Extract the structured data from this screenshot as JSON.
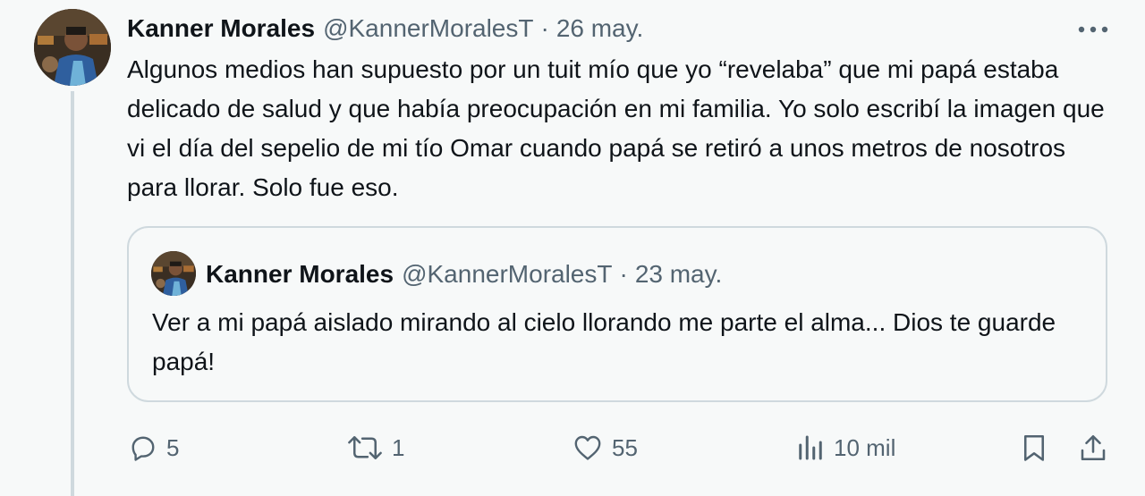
{
  "tweet": {
    "author_name": "Kanner Morales",
    "author_handle": "@KannerMoralesT",
    "separator": "·",
    "date": "26 may.",
    "text": "Algunos medios han supuesto por un tuit mío que yo “revelaba” que mi papá estaba delicado de salud y que había preocupación en mi familia. Yo solo escribí la imagen que vi el día del sepelio de mi tío Omar cuando papá se retiró a unos metros de nosotros para llorar. Solo fue eso.",
    "more_icon": "more-horizontal-icon"
  },
  "quoted_tweet": {
    "author_name": "Kanner Morales",
    "author_handle": "@KannerMoralesT",
    "separator": "·",
    "date": "23 may.",
    "text": "Ver a mi papá aislado mirando al cielo llorando me parte el alma... Dios te guarde papá!"
  },
  "actions": {
    "reply": {
      "icon": "reply-icon",
      "count": "5"
    },
    "retweet": {
      "icon": "retweet-icon",
      "count": "1"
    },
    "like": {
      "icon": "heart-icon",
      "count": "55"
    },
    "views": {
      "icon": "views-icon",
      "count": "10 mil"
    },
    "bookmark": {
      "icon": "bookmark-icon"
    },
    "share": {
      "icon": "share-icon"
    }
  },
  "colors": {
    "background": "#f7f9f9",
    "primary_text": "#0f1419",
    "secondary_text": "#536471",
    "border": "#cfd9de"
  }
}
